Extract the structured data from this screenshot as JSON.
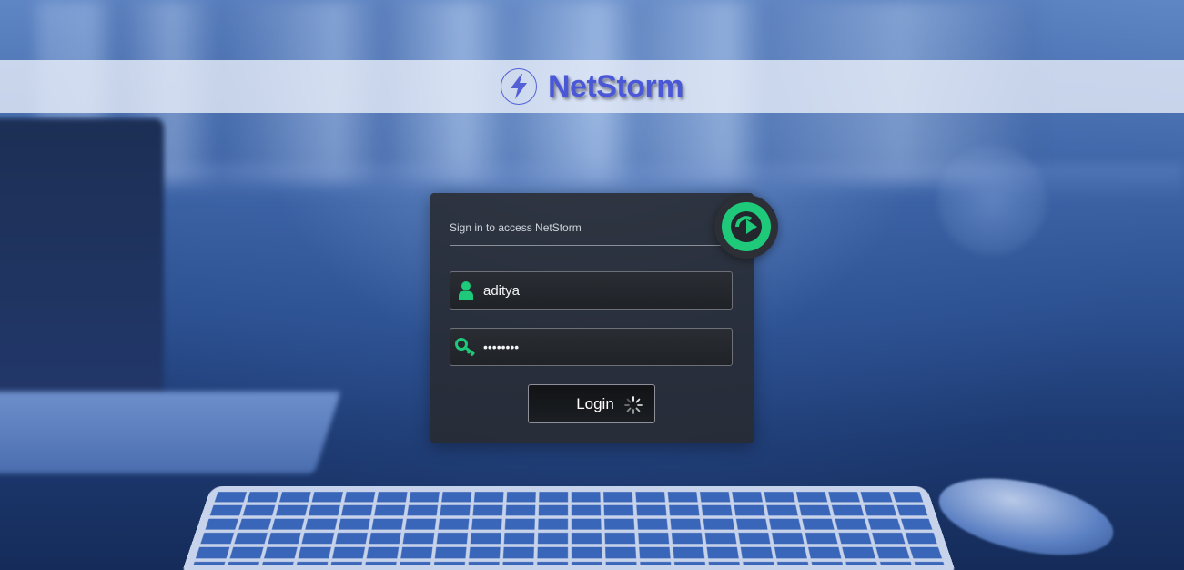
{
  "header": {
    "brand": "NetStorm",
    "logo_icon": "lightning-bolt-icon",
    "brand_color": "#4a58d8"
  },
  "login": {
    "title": "Sign in to access NetStorm",
    "badge_icon": "login-arrow-icon",
    "accent_color": "#1fc97a",
    "username": {
      "value": "aditya",
      "icon": "user-icon"
    },
    "password": {
      "value": "••••••••",
      "icon": "key-icon"
    },
    "submit": {
      "label": "Login",
      "loading_icon": "spinner-icon"
    }
  }
}
